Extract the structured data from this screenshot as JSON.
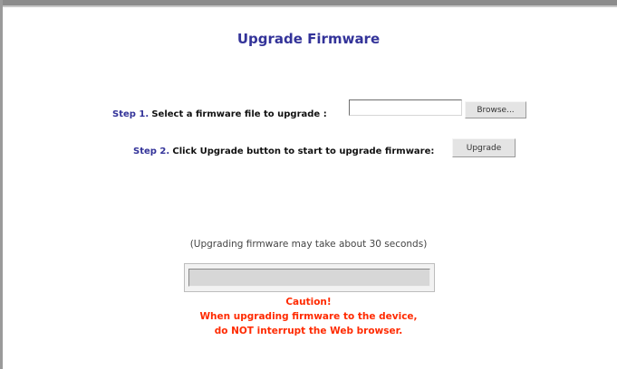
{
  "page": {
    "title": "Upgrade Firmware"
  },
  "step1": {
    "label": "Step 1.",
    "text": "Select a firmware file to upgrade :",
    "file_value": "",
    "browse_label": "Browse..."
  },
  "step2": {
    "label": "Step 2.",
    "text": "Click Upgrade button to start to upgrade firmware:",
    "upgrade_label": "Upgrade"
  },
  "progress": {
    "note": "(Upgrading firmware may take about 30 seconds)",
    "value": 0
  },
  "caution": {
    "title": "Caution!",
    "line1": "When upgrading firmware to the device,",
    "line2": "do NOT interrupt the Web browser."
  },
  "colors": {
    "title": "#333399",
    "caution": "#ff2a00"
  }
}
